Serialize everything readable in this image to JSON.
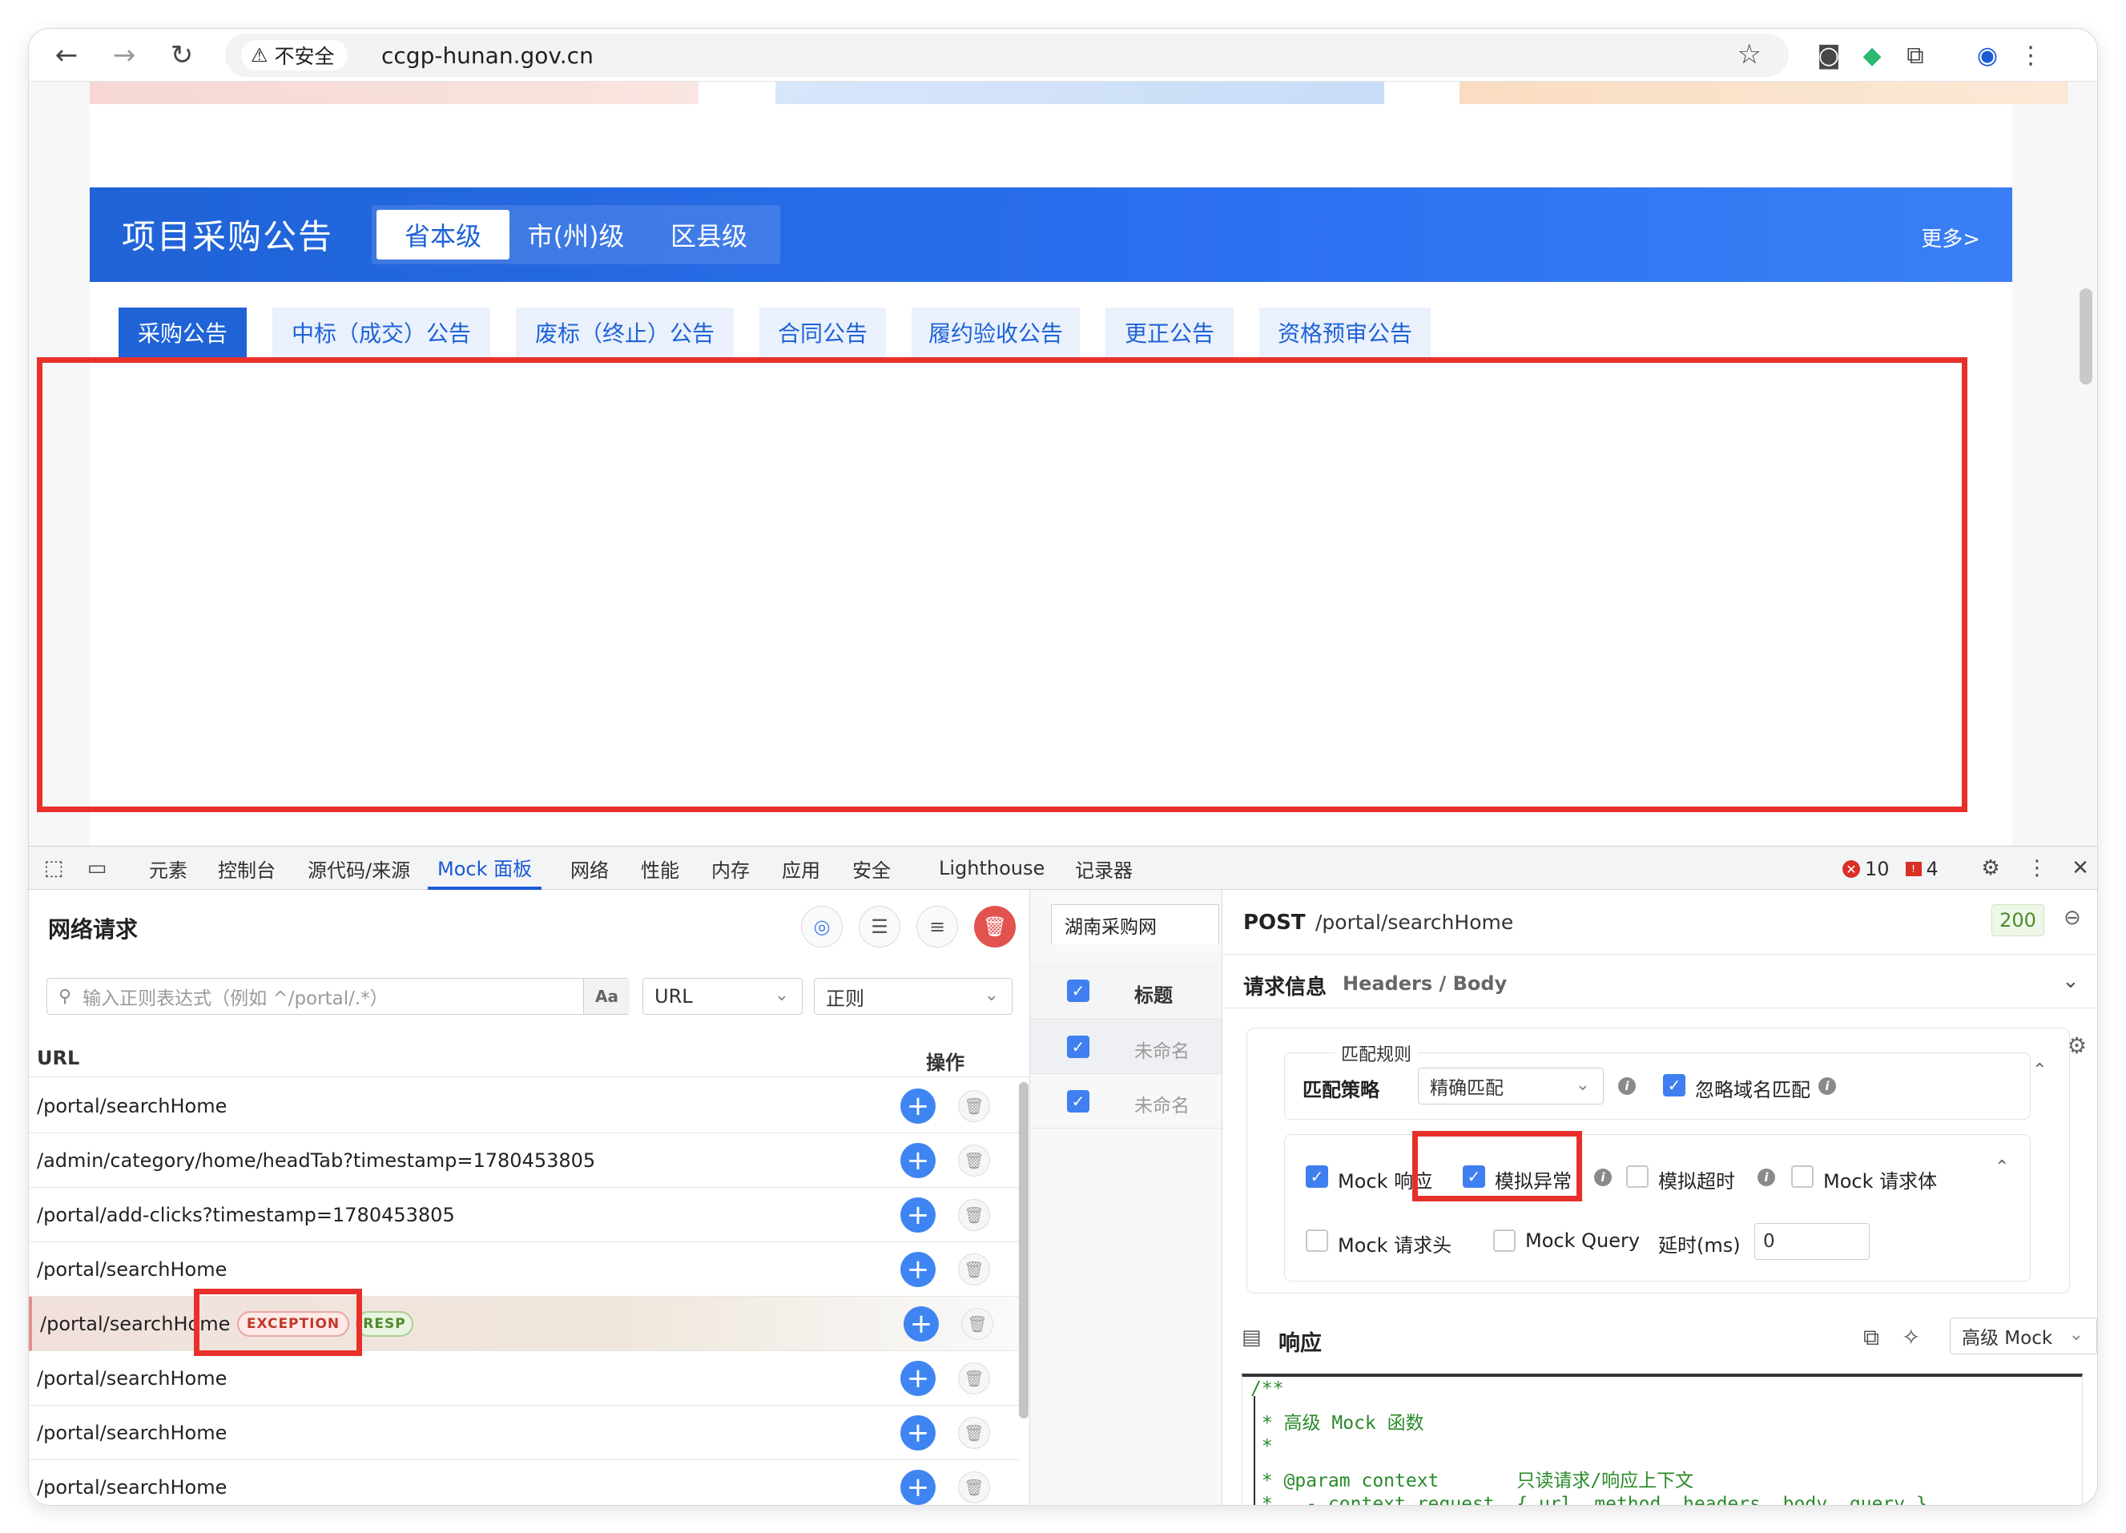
{
  "browser": {
    "security_label": "不安全",
    "url": "ccgp-hunan.gov.cn"
  },
  "page": {
    "section_title": "项目采购公告",
    "levels": [
      "省本级",
      "市(州)级",
      "区县级"
    ],
    "more_label": "更多>",
    "tabs": [
      "采购公告",
      "中标（成交）公告",
      "废标（终止）公告",
      "合同公告",
      "履约验收公告",
      "更正公告",
      "资格预审公告"
    ]
  },
  "devtools": {
    "tabs": [
      "元素",
      "控制台",
      "源代码/来源",
      "Mock 面板",
      "网络",
      "性能",
      "内存",
      "应用",
      "安全",
      "Lighthouse",
      "记录器"
    ],
    "active_tab": "Mock 面板",
    "error_count": "10",
    "warning_count": "4"
  },
  "network_panel": {
    "title": "网络请求",
    "search_placeholder": "输入正则表达式（例如 ^/portal/.*）",
    "case_toggle": "Aa",
    "field_select": "URL",
    "mode_select": "正则",
    "col_url": "URL",
    "col_ops": "操作",
    "rows": [
      "/portal/searchHome",
      "/admin/category/home/headTab?timestamp=1780453805",
      "/portal/add-clicks?timestamp=1780453805",
      "/portal/searchHome",
      "/portal/searchHome",
      "/portal/searchHome",
      "/portal/searchHome",
      "/portal/searchHome"
    ],
    "badge_exception": "EXCEPTION",
    "badge_resp": "RESP"
  },
  "mock_list": {
    "group_tab": "湖南采购网",
    "col_title": "标题",
    "rows": [
      "未命名",
      "未命名"
    ]
  },
  "detail": {
    "method": "POST",
    "path": "/portal/searchHome",
    "status": "200",
    "request_info_label": "请求信息",
    "request_info_sub": "Headers / Body",
    "match_rules_legend": "匹配规则",
    "match_strategy_label": "匹配策略",
    "match_strategy_value": "精确匹配",
    "ignore_domain_label": "忽略域名匹配",
    "opt_mock_response": "Mock 响应",
    "opt_simulate_exception": "模拟异常",
    "opt_simulate_timeout": "模拟超时",
    "opt_mock_body": "Mock 请求体",
    "opt_mock_headers": "Mock 请求头",
    "opt_mock_query": "Mock Query",
    "delay_label": "延时(ms)",
    "delay_value": "0",
    "response_label": "响应",
    "advanced_mock": "高级 Mock",
    "code_lines": [
      "/**",
      " * 高级 Mock 函数",
      " *",
      " * @param context       只读请求/响应上下文",
      " *   - context.request  { url, method, headers, body, query }"
    ]
  }
}
